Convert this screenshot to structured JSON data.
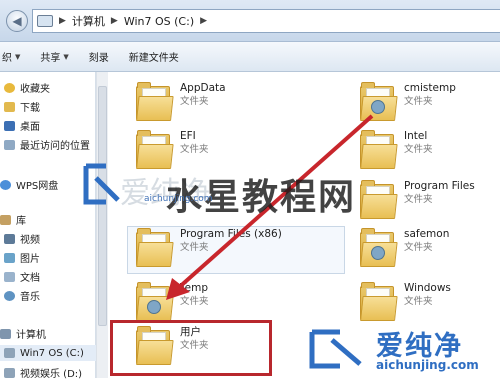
{
  "address_bar": {
    "crumbs": [
      "计算机",
      "Win7 OS (C:)"
    ]
  },
  "toolbar": {
    "organize_label": "织",
    "share_label": "共享",
    "burn_label": "刻录",
    "new_folder_label": "新建文件夹"
  },
  "sidebar": {
    "items": [
      {
        "label": "收藏夹",
        "icon": "star-icon"
      },
      {
        "label": "下载",
        "icon": "download-folder-icon"
      },
      {
        "label": "桌面",
        "icon": "desktop-icon"
      },
      {
        "label": "最近访问的位置",
        "icon": "recent-places-icon"
      },
      {
        "label": "WPS网盘",
        "icon": "cloud-icon"
      },
      {
        "label": "库",
        "icon": "library-icon"
      },
      {
        "label": "视频",
        "icon": "video-library-icon"
      },
      {
        "label": "图片",
        "icon": "pictures-library-icon"
      },
      {
        "label": "文档",
        "icon": "documents-library-icon"
      },
      {
        "label": "音乐",
        "icon": "music-library-icon"
      },
      {
        "label": "计算机",
        "icon": "computer-icon"
      },
      {
        "label": "Win7 OS (C:)",
        "icon": "drive-icon"
      },
      {
        "label": "视频娱乐 (D:)",
        "icon": "drive-icon"
      }
    ]
  },
  "files": {
    "type_label": "文件夹",
    "left": [
      "AppData",
      "EFI",
      "Program Files (x86)",
      "Temp",
      "用户"
    ],
    "right": [
      "cmistemp",
      "Intel",
      "Program Files",
      "safemon",
      "Windows"
    ]
  },
  "watermarks": {
    "center_cn": "水星教程网",
    "center_light": "爱纯净",
    "center_url": "aichunjing.com",
    "brand_cn": "爱纯净",
    "brand_url": "aichunjing.com"
  },
  "colors": {
    "highlight_frame": "#b8272d",
    "arrow": "#c8262c",
    "brand_blue": "#2f6ec2"
  }
}
